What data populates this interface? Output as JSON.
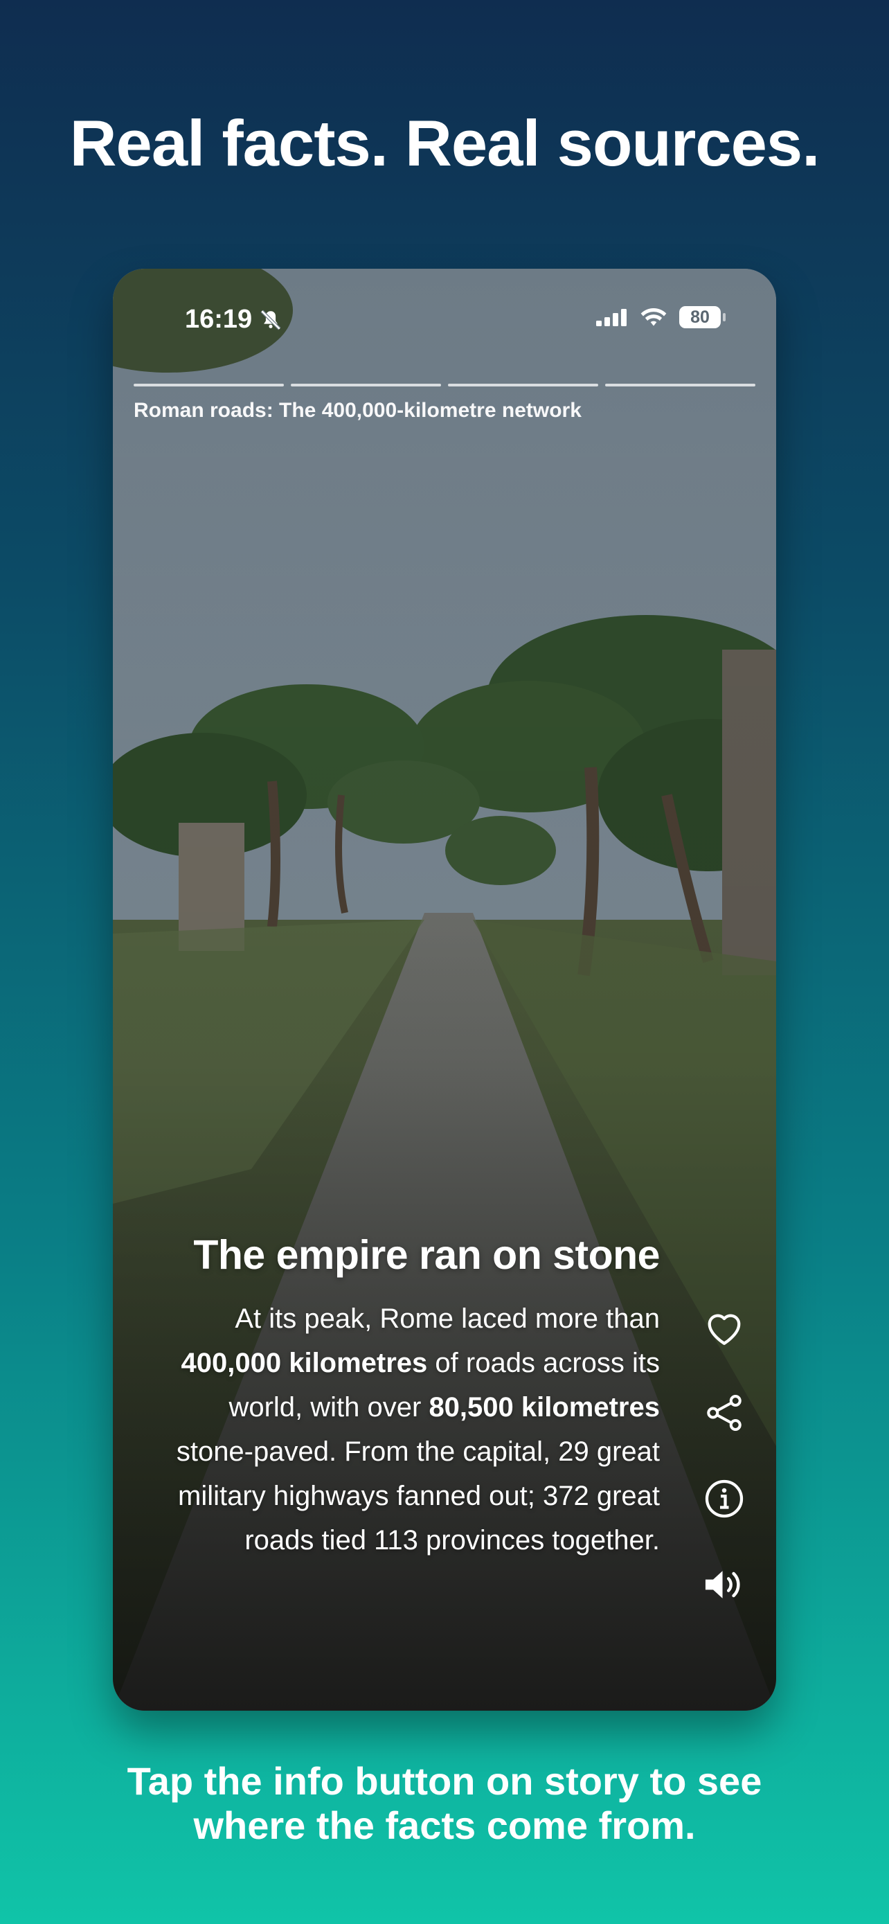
{
  "headline": "Real facts. Real sources.",
  "status_bar": {
    "time": "16:19",
    "battery": "80",
    "icons": [
      "bell-slash-icon",
      "cellular-signal-icon",
      "wifi-icon",
      "battery-icon"
    ]
  },
  "story": {
    "title": "Roman roads: The 400,000-kilometre network",
    "progress_segments": 4,
    "heading": "The empire ran on stone",
    "body": {
      "t1": "At its peak, Rome laced more than ",
      "b1": "400,000 kilometres",
      "t2": " of roads across its world, with over ",
      "b2": "80,500 kilometres",
      "t3": " stone-paved. From the capital, 29 great military highways fanned out; 372 great roads tied 113 provinces together."
    },
    "actions": [
      "heart-icon",
      "share-icon",
      "info-icon",
      "speaker-icon"
    ]
  },
  "caption": {
    "line1": "Tap the info button on story to see",
    "line2": "where the facts come from."
  },
  "colors": {
    "bg_top": "#0f2d50",
    "bg_bottom": "#10c4a8",
    "text": "#ffffff"
  }
}
